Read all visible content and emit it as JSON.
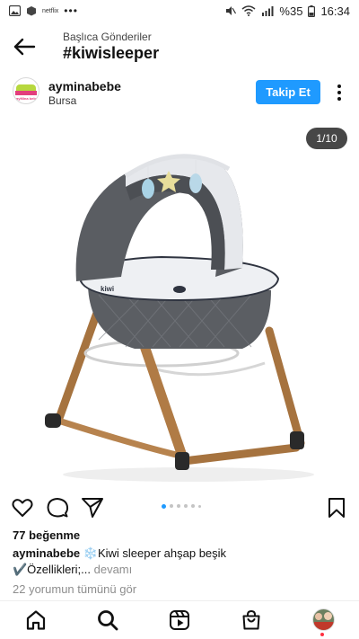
{
  "status_bar": {
    "mini_label": "netflix",
    "dots": "•••",
    "battery": "%35",
    "time": "16:34",
    "icons": [
      "image-icon",
      "box-icon",
      "mute-icon",
      "wifi-icon",
      "signal-icon",
      "battery-icon"
    ]
  },
  "header": {
    "subtitle": "Başlıca Gönderiler",
    "title": "#kiwisleeper"
  },
  "post": {
    "account": "ayminabebe",
    "location": "Bursa",
    "follow_label": "Takip Et",
    "avatar_text": "ayMina bebe",
    "image_counter": "1/10",
    "carousel": {
      "total_dots": 6,
      "active_index": 0
    },
    "likes": "77 beğenme",
    "caption_user": "ayminabebe",
    "caption_line1": "❄️Kiwi sleeper ahşap beşik",
    "caption_line2": "✔️Özellikleri;...",
    "caption_more": "devamı",
    "comments_link": "22 yorumun tümünü gör",
    "product_logo": "kiwi"
  },
  "colors": {
    "accent": "#1f9aff",
    "text": "#111111",
    "muted": "#8e8e8e",
    "notification": "#ff3040"
  }
}
